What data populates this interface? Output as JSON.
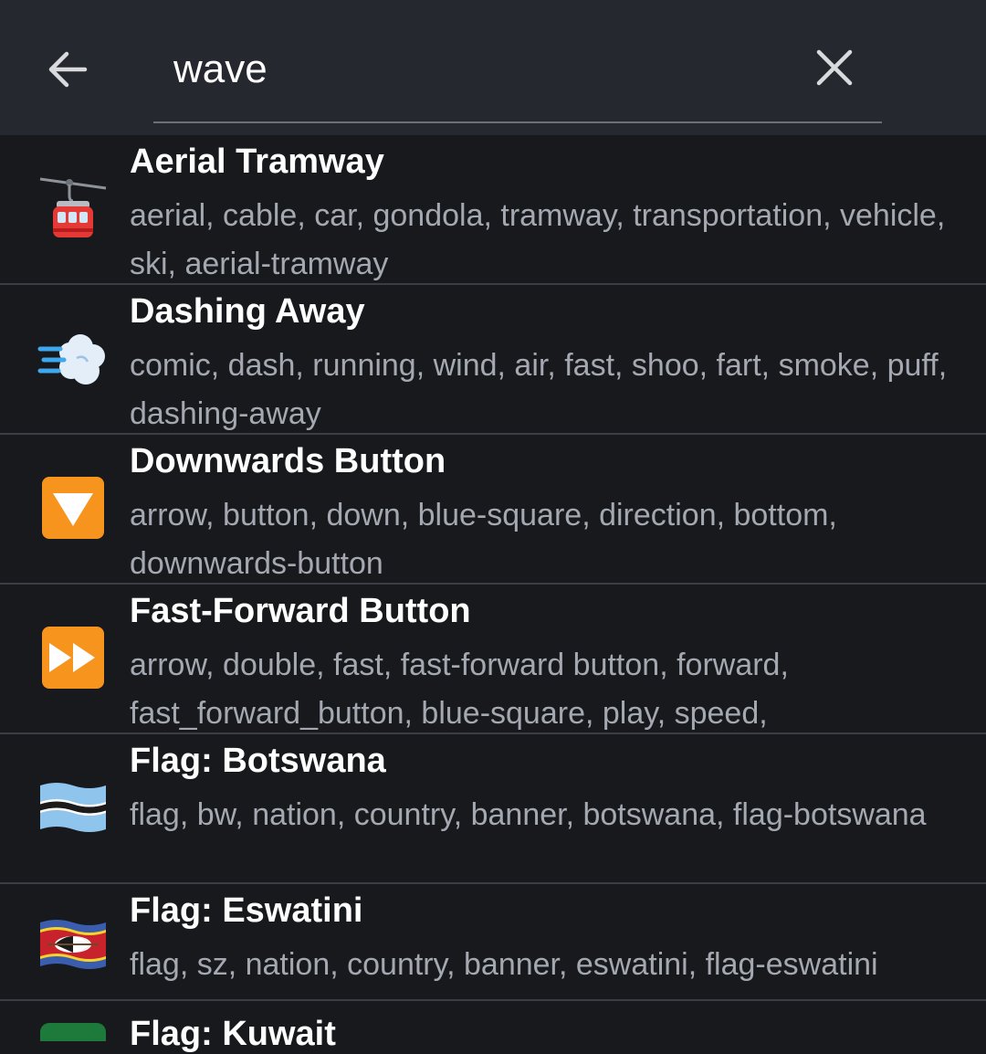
{
  "search": {
    "value": "wave"
  },
  "results": [
    {
      "title": "Aerial Tramway",
      "keywords": "aerial, cable, car, gondola, tramway, transportation, vehicle, ski, aerial-tramway",
      "icon": "aerial-tramway-icon"
    },
    {
      "title": "Dashing Away",
      "keywords": "comic, dash, running, wind, air, fast, shoo, fart, smoke, puff, dashing-away",
      "icon": "dashing-away-icon"
    },
    {
      "title": "Downwards Button",
      "keywords": "arrow, button, down, blue-square, direction, bottom, downwards-button",
      "icon": "downwards-button-icon"
    },
    {
      "title": "Fast-Forward Button",
      "keywords": "arrow, double, fast, fast-forward button, forward, fast_forward_button, blue-square, play, speed,",
      "icon": "fast-forward-button-icon"
    },
    {
      "title": "Flag: Botswana",
      "keywords": "flag, bw, nation, country, banner, botswana, flag-botswana",
      "icon": "flag-botswana-icon"
    },
    {
      "title": "Flag: Eswatini",
      "keywords": "flag, sz, nation, country, banner, eswatini, flag-eswatini",
      "icon": "flag-eswatini-icon"
    },
    {
      "title": "Flag: Kuwait",
      "icon": "flag-kuwait-icon"
    }
  ],
  "colors": {
    "header_bg": "#25282e",
    "list_bg": "#17191d",
    "divider": "#3a3d43",
    "keyword_text": "#a4a8b0",
    "button_orange": "#f7941d"
  }
}
